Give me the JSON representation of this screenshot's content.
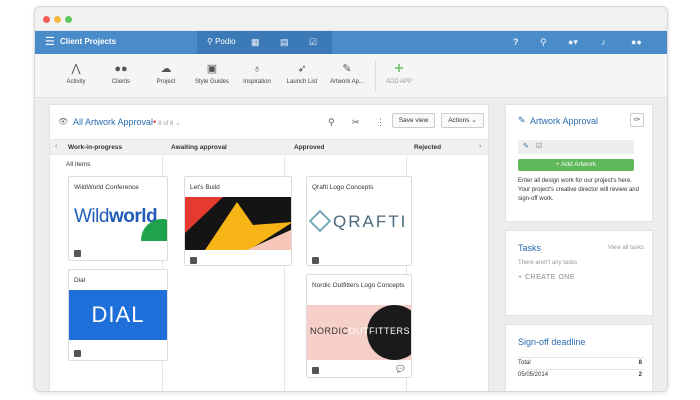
{
  "topbar": {
    "workspace": "Client Projects",
    "brand": "Podio"
  },
  "apps": [
    {
      "label": "Activity",
      "icon": "activity-icon",
      "glyph": "⋀"
    },
    {
      "label": "Clients",
      "icon": "clients-icon",
      "glyph": "●●"
    },
    {
      "label": "Project",
      "icon": "project-icon",
      "glyph": "☁"
    },
    {
      "label": "Style Guides",
      "icon": "briefcase-icon",
      "glyph": "▣"
    },
    {
      "label": "Inspiration",
      "icon": "lightbulb-icon",
      "glyph": "♁"
    },
    {
      "label": "Launch List",
      "icon": "rocket-icon",
      "glyph": "➶"
    },
    {
      "label": "Artwork Ap...",
      "icon": "brush-icon",
      "glyph": "✎"
    }
  ],
  "add_app": {
    "label": "ADD APP",
    "glyph": "+"
  },
  "view": {
    "title": "All Artwork Approval",
    "required_mark": "•",
    "count": "8 of 8",
    "save_view": "Save view",
    "actions": "Actions"
  },
  "columns": [
    "Work-in-progress",
    "Awaiting approval",
    "Approved",
    "Rejected"
  ],
  "all_items": "All items",
  "cards": {
    "wildworld": {
      "title": "WildWorld Conference",
      "logo_a": "Wild",
      "logo_b": "world"
    },
    "dial": {
      "title": "Dial",
      "logo": "DIAL"
    },
    "letsbuild": {
      "title": "Let's Build"
    },
    "qrafti": {
      "title": "Qrafti Logo Concepts",
      "logo": "QRAFTI"
    },
    "nordic": {
      "title": "Nordic Outfitters Logo Concepts",
      "logo_a": "NORDIC",
      "logo_b": "OUTFITTERS"
    }
  },
  "sidebar": {
    "app_title": "Artwork Approval",
    "add_button": "+ Add Artwork",
    "description": "Enter all design work for our project's here. Your project's creative director will review and sign-off work.",
    "tasks_title": "Tasks",
    "tasks_view_all": "View all tasks",
    "tasks_empty": "There aren't any tasks",
    "tasks_create": "+ CREATE ONE",
    "signoff_title": "Sign-off deadline",
    "signoff_rows": [
      {
        "label": "Total",
        "value": "8"
      },
      {
        "label": "05/05/2014",
        "value": "2"
      }
    ]
  },
  "colors": {
    "topbar": "#4a8bc9",
    "link_blue": "#2a6cb0",
    "add_green": "#7cc576"
  }
}
